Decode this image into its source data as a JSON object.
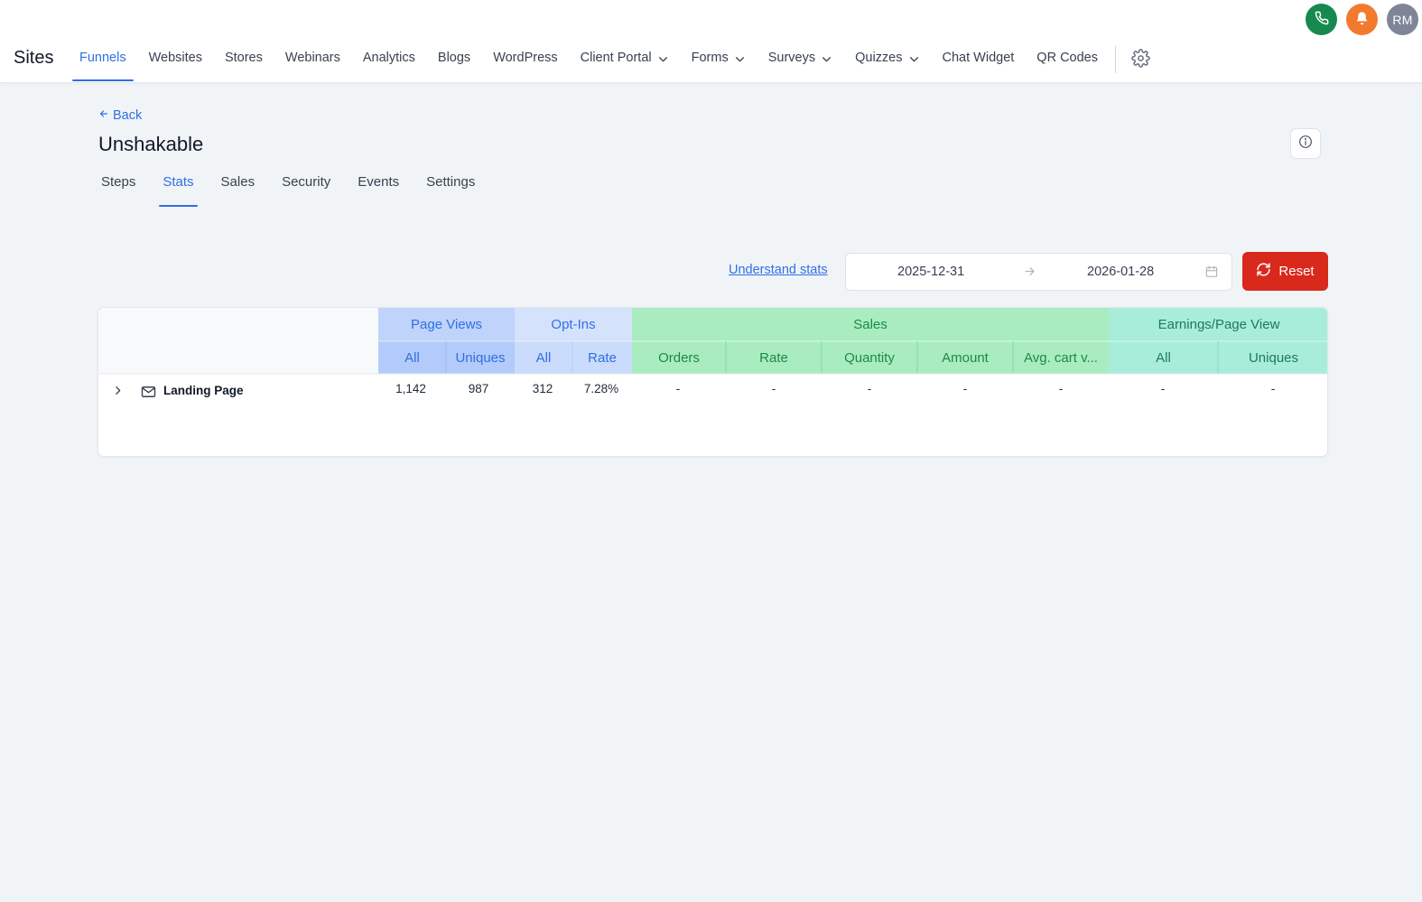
{
  "header": {
    "app_title": "Sites",
    "nav": [
      {
        "label": "Funnels",
        "active": true,
        "dropdown": false
      },
      {
        "label": "Websites",
        "active": false,
        "dropdown": false
      },
      {
        "label": "Stores",
        "active": false,
        "dropdown": false
      },
      {
        "label": "Webinars",
        "active": false,
        "dropdown": false
      },
      {
        "label": "Analytics",
        "active": false,
        "dropdown": false
      },
      {
        "label": "Blogs",
        "active": false,
        "dropdown": false
      },
      {
        "label": "WordPress",
        "active": false,
        "dropdown": false
      },
      {
        "label": "Client Portal",
        "active": false,
        "dropdown": true
      },
      {
        "label": "Forms",
        "active": false,
        "dropdown": true
      },
      {
        "label": "Surveys",
        "active": false,
        "dropdown": true
      },
      {
        "label": "Quizzes",
        "active": false,
        "dropdown": true
      },
      {
        "label": "Chat Widget",
        "active": false,
        "dropdown": false
      },
      {
        "label": "QR Codes",
        "active": false,
        "dropdown": false
      }
    ],
    "settings_icon": "gear-icon",
    "top_actions": {
      "phone_icon": "phone-icon",
      "bell_icon": "bell-icon",
      "avatar_initials": "RM",
      "phone_color": "#16894f",
      "bell_color": "#f27a2e",
      "avatar_color": "#7d8597"
    }
  },
  "page": {
    "back_label": "Back",
    "title": "Unshakable",
    "info_icon": "info-icon",
    "tabs": [
      {
        "label": "Steps",
        "active": false
      },
      {
        "label": "Stats",
        "active": true
      },
      {
        "label": "Sales",
        "active": false
      },
      {
        "label": "Security",
        "active": false
      },
      {
        "label": "Events",
        "active": false
      },
      {
        "label": "Settings",
        "active": false
      }
    ]
  },
  "filters": {
    "understand_stats_label": "Understand stats",
    "start_date": "2025-12-31",
    "end_date": "2026-01-28",
    "reset_label": "Reset",
    "reset_color": "#d9291c"
  },
  "table": {
    "groups": [
      {
        "label": "Page Views",
        "tone": "blue"
      },
      {
        "label": "Opt-Ins",
        "tone": "blue"
      },
      {
        "label": "Sales",
        "tone": "green"
      },
      {
        "label": "Earnings/Page View",
        "tone": "teal"
      }
    ],
    "columns": [
      "All",
      "Uniques",
      "All",
      "Rate",
      "Orders",
      "Rate",
      "Quantity",
      "Amount",
      "Avg. cart v...",
      "All",
      "Uniques"
    ],
    "rows": [
      {
        "name": "Landing Page",
        "icon": "mail-icon",
        "values": [
          "1,142",
          "987",
          "312",
          "7.28%",
          "-",
          "-",
          "-",
          "-",
          "-",
          "-",
          "-"
        ]
      }
    ],
    "colors": {
      "page_views": "#bfd3fb",
      "opt_ins": "#d4e2fc",
      "sales": "#a9ecc0",
      "earnings": "#a8edd9"
    }
  }
}
